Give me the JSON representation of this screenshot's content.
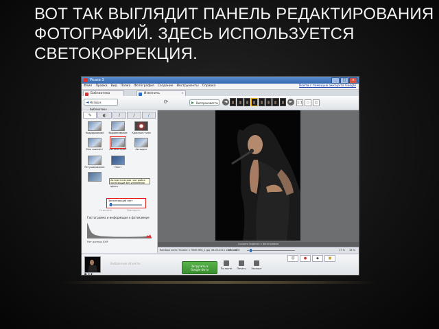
{
  "slide": {
    "title_lines": [
      "ВОТ ТАК ВЫГЛЯДИТ ПАНЕЛЬ РЕДАКТИРОВАНИЯ",
      "ФОТОГРАФИЙ. ЗДЕСЬ ИСПОЛЬЗУЕТСЯ",
      "СВЕТОКОРРЕКЦИЯ."
    ]
  },
  "window": {
    "title": "Picasa 3",
    "buttons": [
      "_",
      "□",
      "×"
    ]
  },
  "menubar": {
    "items": [
      "Файл",
      "Правка",
      "Вид",
      "Папка",
      "Фотография",
      "Создание",
      "Инструменты",
      "Справка"
    ],
    "signin": "Войти с помощью аккаунта Google"
  },
  "tabs": [
    {
      "label": "Библиотека",
      "icon": "library-icon"
    },
    {
      "label": "Изменить",
      "icon": "edit-icon"
    }
  ],
  "toolbar": {
    "back_label": "Назад в библиотеку",
    "slideshow_label": "Воспроизвести",
    "view_buttons": [
      "1:1",
      "▭",
      "◫"
    ]
  },
  "edit_panel": {
    "tabs": [
      "wrench-icon",
      "contrast-icon",
      "brush-icon",
      "pen-icon",
      "brush-blue-icon"
    ],
    "tools": [
      {
        "label": "Кадрирование",
        "name": "crop-tool"
      },
      {
        "label": "Выравнивание",
        "name": "straighten-tool"
      },
      {
        "label": "Красные глаза",
        "name": "redeye-tool"
      },
      {
        "label": "Мне повезёт!",
        "name": "lucky-tool"
      },
      {
        "label": "Автоконтраст",
        "name": "auto-contrast-tool"
      },
      {
        "label": "Автоцвет",
        "name": "auto-color-tool"
      },
      {
        "label": "Ретуширование",
        "name": "retouch-tool"
      },
      {
        "label": "Текст",
        "name": "text-tool"
      },
      {
        "label": "",
        "name": "blank-tool"
      }
    ],
    "tooltip": "Автоматическая настройка экспозиции без изменения цвета",
    "slider_label": "Заполняющий свет",
    "faded_labels": [
      "Отменить",
      "Повторить"
    ],
    "histogram_title": "Гистограмма и информация о фотокамере",
    "histogram_note": "Нет данных EXIF"
  },
  "photo": {
    "caption": "Создать подпись к фотографии",
    "file_name": "Rainbow Cleric Theatre > 9089 IMG_1.jpg",
    "date": "08.03.2011 10:51:14",
    "size": "480 x 800",
    "zoom_value_1": "17 %",
    "zoom_value_2": "18 %"
  },
  "bottom": {
    "tray_label": "Выбранные объекты",
    "tray_actions": "● ⊕ ◐",
    "upload_label_1": "Загрузить в",
    "upload_label_2": "Google Фото",
    "actions": [
      {
        "label": "По почте",
        "icon": "email-icon"
      },
      {
        "label": "Печать",
        "icon": "print-icon"
      },
      {
        "label": "Экспорт",
        "icon": "export-icon"
      }
    ],
    "right_icons": [
      "person-icon",
      "pin-icon",
      "tag-icon",
      "folder-icon"
    ]
  },
  "colors": {
    "accent_green": "#3a8f2f",
    "highlight_red": "#e01a16",
    "title_blue": "#3569b0"
  }
}
